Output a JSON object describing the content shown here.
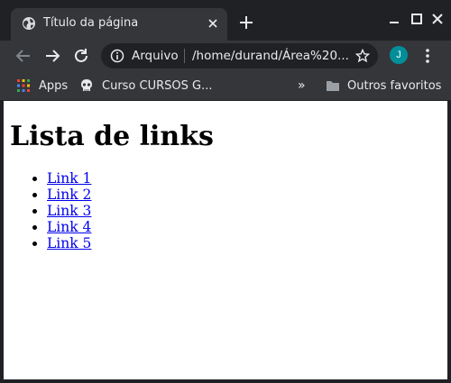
{
  "tab": {
    "title": "Título da página"
  },
  "omnibox": {
    "security_label": "Arquivo",
    "url": "/home/durand/Área%20..."
  },
  "profile": {
    "initial": "J",
    "color": "#008f9a"
  },
  "bookmarks": {
    "apps": "Apps",
    "curso": "Curso CURSOS G...",
    "other": "Outros favoritos"
  },
  "page": {
    "heading": "Lista de links",
    "links": [
      "Link 1",
      "Link 2",
      "Link 3",
      "Link 4",
      "Link 5"
    ]
  },
  "icons": [
    "globe-icon",
    "close-icon",
    "plus-icon",
    "minimize-icon",
    "maximize-icon",
    "back-icon",
    "forward-icon",
    "reload-icon",
    "info-icon",
    "star-icon",
    "more-icon",
    "apps-icon",
    "skull-icon",
    "chevron-double-right-icon",
    "folder-icon"
  ]
}
